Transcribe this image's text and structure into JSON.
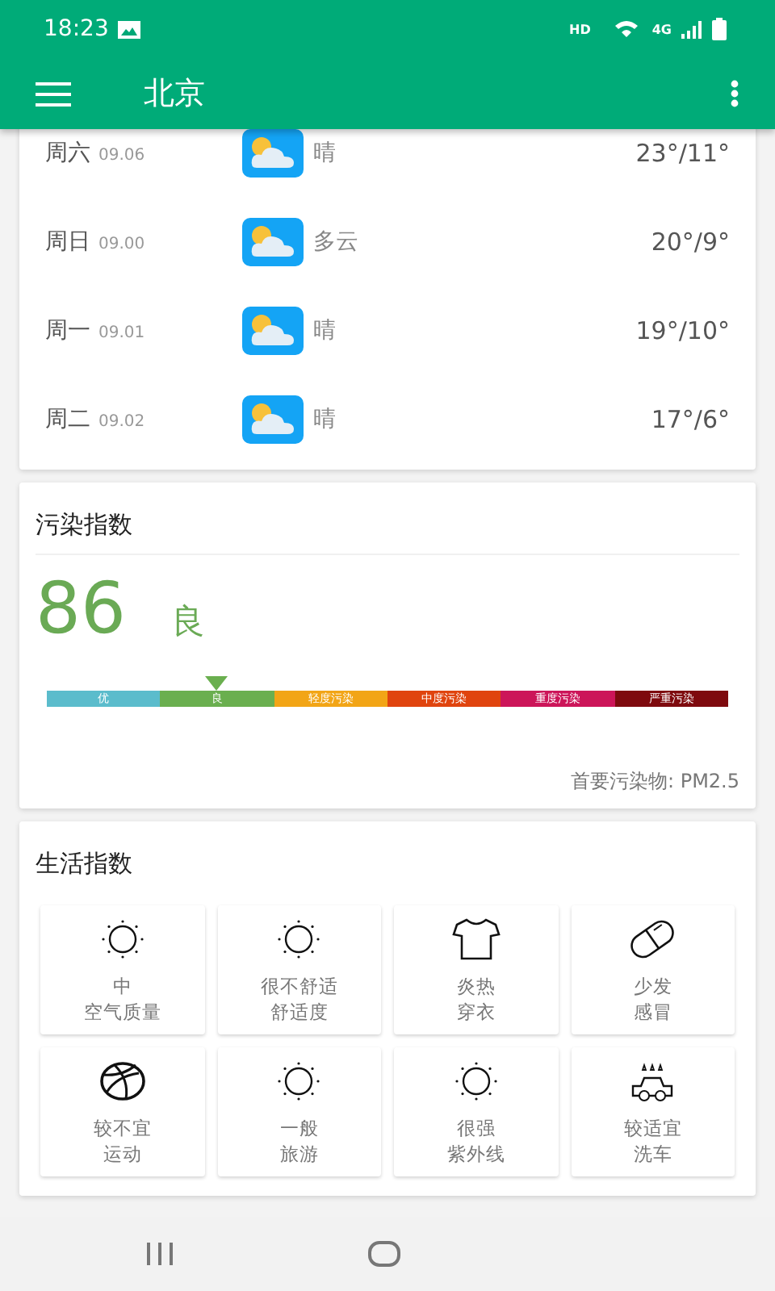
{
  "status_bar": {
    "time": "18:23",
    "hd": "HD",
    "network": "4G"
  },
  "app_bar": {
    "title": "北京"
  },
  "forecast": [
    {
      "day": "周六",
      "date": "09.06",
      "condition": "晴",
      "temp": "23°/11°"
    },
    {
      "day": "周日",
      "date": "09.00",
      "condition": "多云",
      "temp": "20°/9°"
    },
    {
      "day": "周一",
      "date": "09.01",
      "condition": "晴",
      "temp": "19°/10°"
    },
    {
      "day": "周二",
      "date": "09.02",
      "condition": "晴",
      "temp": "17°/6°"
    }
  ],
  "pollution": {
    "title": "污染指数",
    "aqi": "86",
    "grade": "良",
    "scale": [
      {
        "label": "优",
        "color": "#5bbccc",
        "selected": false
      },
      {
        "label": "良",
        "color": "#6aaf4f",
        "selected": true
      },
      {
        "label": "轻度污染",
        "color": "#f2a516",
        "selected": false
      },
      {
        "label": "中度污染",
        "color": "#e0440e",
        "selected": false
      },
      {
        "label": "重度污染",
        "color": "#cc1559",
        "selected": false
      },
      {
        "label": "严重污染",
        "color": "#7e0a0e",
        "selected": false
      }
    ],
    "primary": "首要污染物: PM2.5"
  },
  "life": {
    "title": "生活指数",
    "items": [
      {
        "kind": "sun",
        "value": "中",
        "name": "空气质量"
      },
      {
        "kind": "sun",
        "value": "很不舒适",
        "name": "舒适度"
      },
      {
        "kind": "shirt",
        "value": "炎热",
        "name": "穿衣"
      },
      {
        "kind": "pill",
        "value": "少发",
        "name": "感冒"
      },
      {
        "kind": "ball",
        "value": "较不宜",
        "name": "运动"
      },
      {
        "kind": "sun",
        "value": "一般",
        "name": "旅游"
      },
      {
        "kind": "sun",
        "value": "很强",
        "name": "紫外线"
      },
      {
        "kind": "car",
        "value": "较适宜",
        "name": "洗车"
      }
    ]
  }
}
